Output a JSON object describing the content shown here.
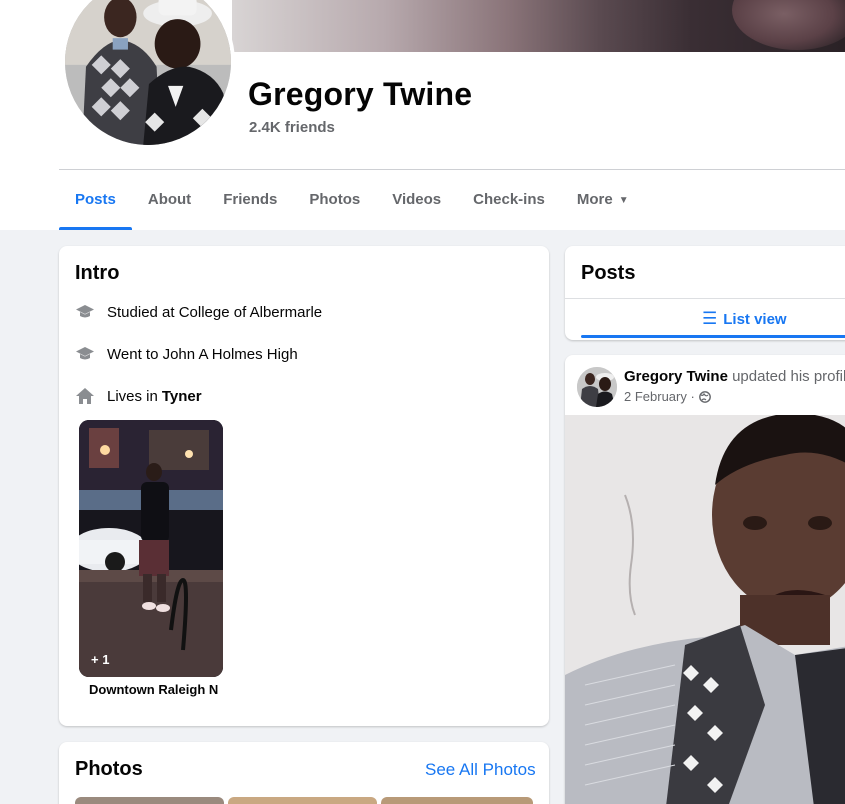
{
  "profile": {
    "name": "Gregory Twine",
    "friends": "2.4K friends"
  },
  "tabs": [
    {
      "label": "Posts",
      "active": true
    },
    {
      "label": "About"
    },
    {
      "label": "Friends"
    },
    {
      "label": "Photos"
    },
    {
      "label": "Videos"
    },
    {
      "label": "Check-ins"
    },
    {
      "label": "More"
    }
  ],
  "intro": {
    "title": "Intro",
    "items": [
      {
        "icon": "graduation-cap-icon",
        "text": "Studied at College of Albermarle"
      },
      {
        "icon": "graduation-cap-icon",
        "text": "Went to John A Holmes High"
      },
      {
        "icon": "home-icon",
        "prefix": "Lives in",
        "place": "Tyner"
      }
    ],
    "featured": {
      "count": "+ 1",
      "caption": "Downtown Raleigh N"
    }
  },
  "photos": {
    "title": "Photos",
    "see_all": "See All Photos"
  },
  "posts": {
    "title": "Posts",
    "list_view": "List view"
  },
  "post": {
    "author": "Gregory Twine",
    "action": "updated his profil",
    "date": "2 February ·"
  },
  "colors": {
    "accent": "#1877f2",
    "secondary_text": "#65676b",
    "background": "#f0f2f5"
  }
}
